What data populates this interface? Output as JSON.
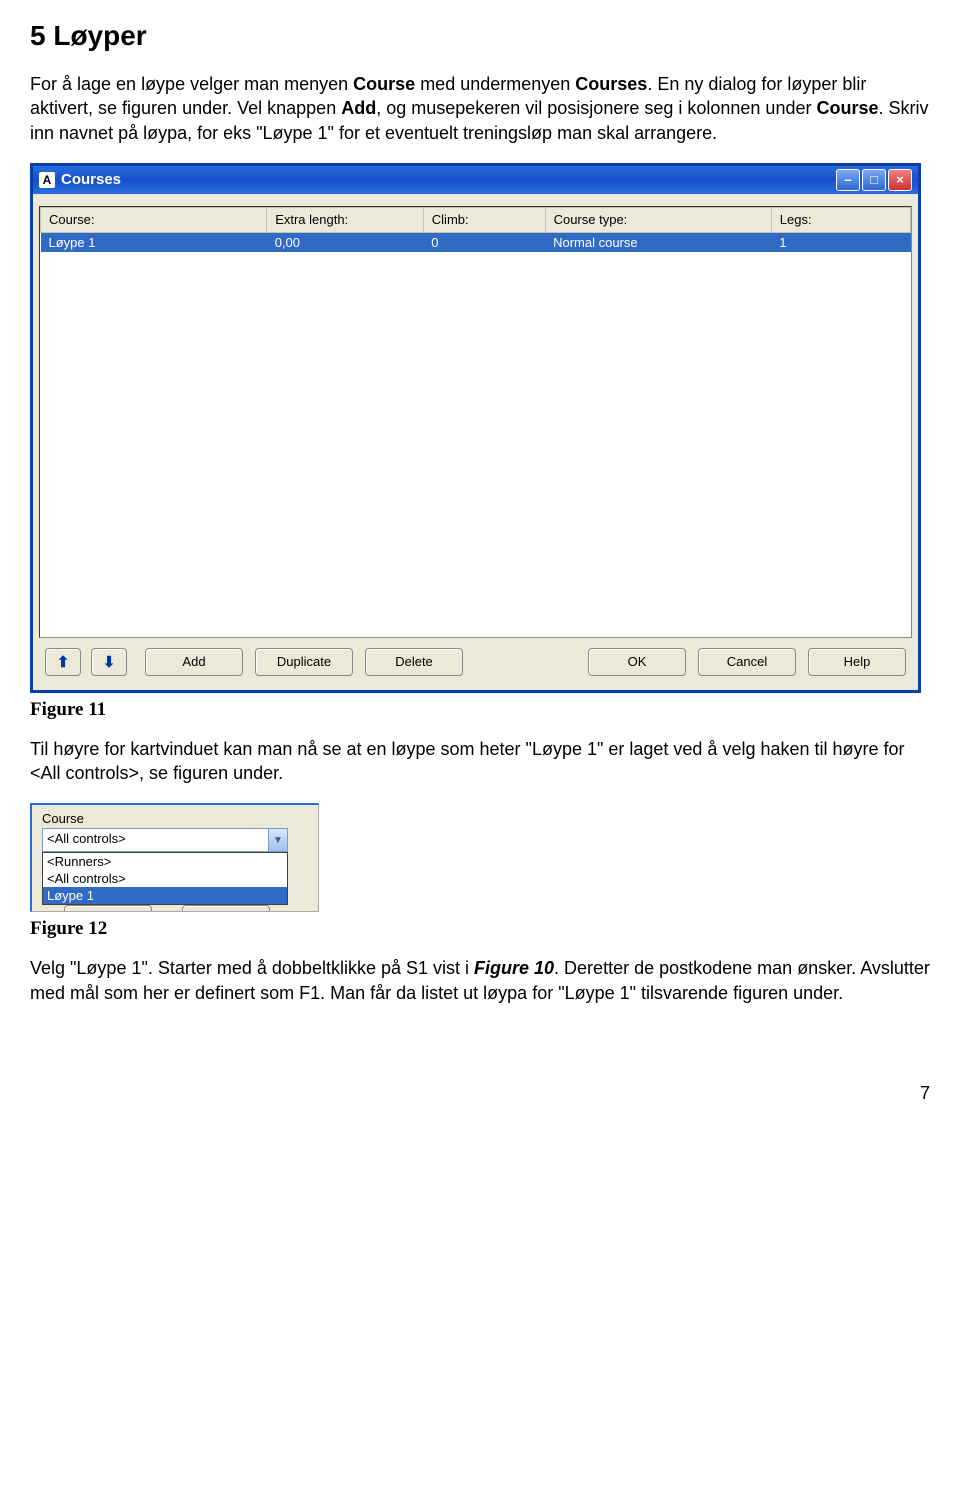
{
  "section": {
    "heading": "5  Løyper"
  },
  "p1": {
    "t1": "For å lage en løype velger man menyen ",
    "b1": "Course",
    "t2": " med undermenyen ",
    "b2": "Courses",
    "t3": ". En ny dialog for løyper blir aktivert, se figuren under. Vel knappen ",
    "b3": "Add",
    "t4": ", og musepekeren vil posisjonere seg i kolonnen under ",
    "b4": "Course",
    "t5": ". Skriv inn navnet på løypa, for eks \"Løype 1\" for et eventuelt treningsløp man skal arrangere."
  },
  "dialog": {
    "appicon": "A",
    "title": "Courses",
    "headers": [
      "Course:",
      "Extra length:",
      "Climb:",
      "Course type:",
      "Legs:"
    ],
    "row": [
      "Løype 1",
      "0,00",
      "0",
      "Normal course",
      "1"
    ],
    "buttons": {
      "add": "Add",
      "duplicate": "Duplicate",
      "delete": "Delete",
      "ok": "OK",
      "cancel": "Cancel",
      "help": "Help"
    }
  },
  "fig11": "Figure 11",
  "p2": "Til høyre for kartvinduet kan man nå se at en løype som heter \"Løype 1\" er laget ved å velg haken til høyre for  <All controls>, se figuren under.",
  "snippet": {
    "label": "Course",
    "selected": "<All controls>",
    "options": [
      "<Runners>",
      "<All controls>",
      "Løype 1"
    ]
  },
  "fig12": "Figure 12",
  "p3": {
    "t1": "Velg \"Løype 1\". Starter med å dobbeltklikke på S1 vist i ",
    "b1": "Figure 10",
    "t2": ". Deretter de postkodene man ønsker. Avslutter med mål som her er definert som F1. Man får da listet ut løypa for \"Løype 1\" tilsvarende figuren under."
  },
  "pagenum": "7"
}
